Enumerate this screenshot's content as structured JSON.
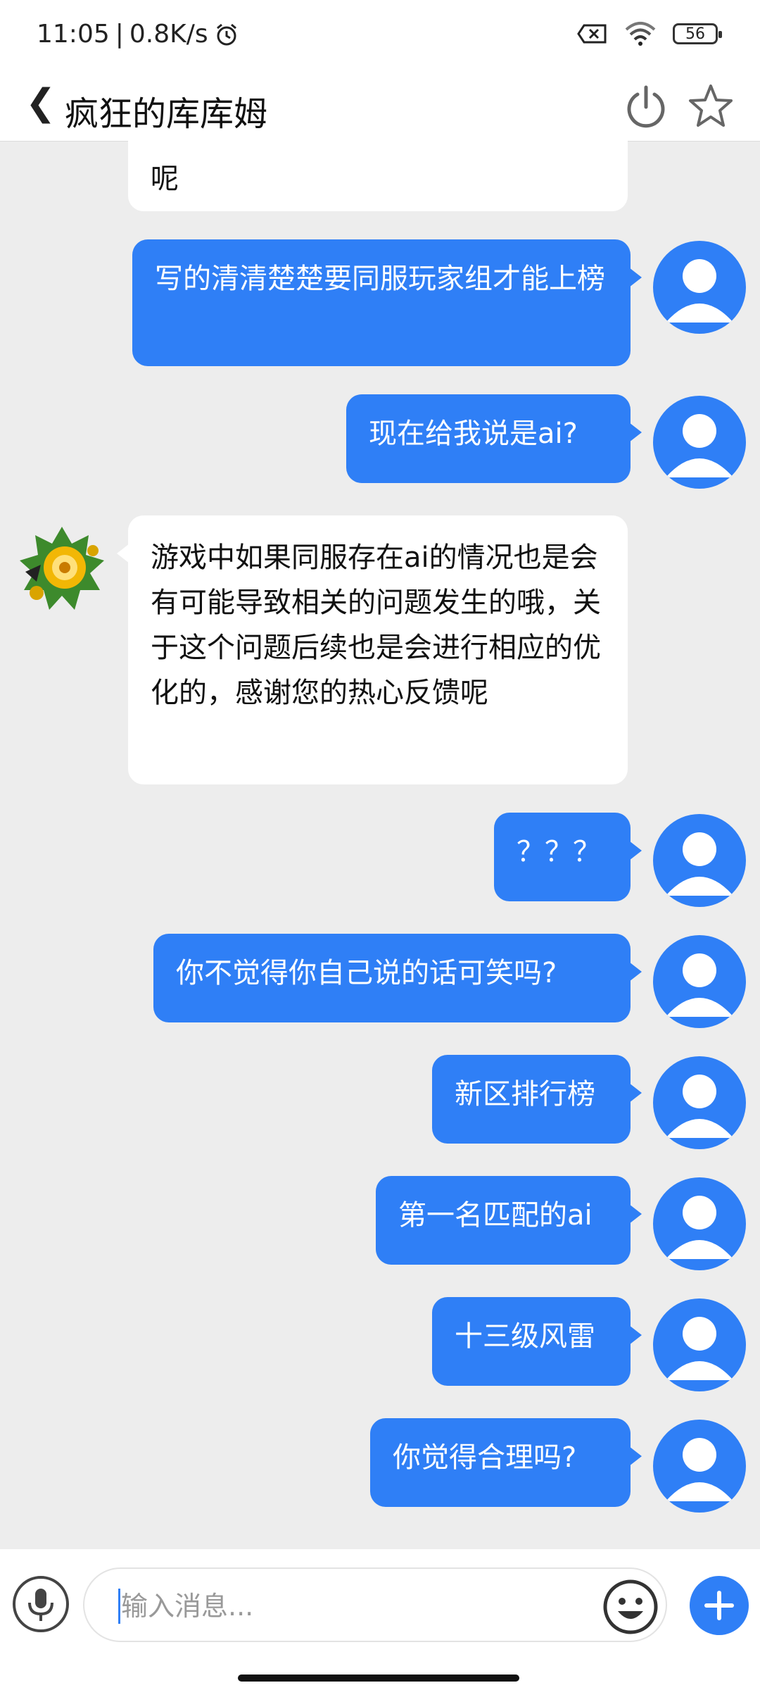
{
  "status_bar": {
    "time": "11:05",
    "speed": "0.8K/s",
    "battery": "56"
  },
  "header": {
    "title": "疯狂的库库姆"
  },
  "messages": [
    {
      "from": "bot",
      "text": "呢"
    },
    {
      "from": "user",
      "text": "写的清清楚楚要同服玩家组才能上榜"
    },
    {
      "from": "user",
      "text": "现在给我说是ai?"
    },
    {
      "from": "bot",
      "text": "游戏中如果同服存在ai的情况也是会有可能导致相关的问题发生的哦，关于这个问题后续也是会进行相应的优化的，感谢您的热心反馈呢"
    },
    {
      "from": "user",
      "text": "？？？"
    },
    {
      "from": "user",
      "text": "你不觉得你自己说的话可笑吗?"
    },
    {
      "from": "user",
      "text": "新区排行榜"
    },
    {
      "from": "user",
      "text": "第一名匹配的ai"
    },
    {
      "from": "user",
      "text": "十三级风雷"
    },
    {
      "from": "user",
      "text": "你觉得合理吗?"
    }
  ],
  "input": {
    "placeholder": "输入消息..."
  },
  "colors": {
    "accent": "#2f7ff6",
    "background": "#ededed"
  }
}
